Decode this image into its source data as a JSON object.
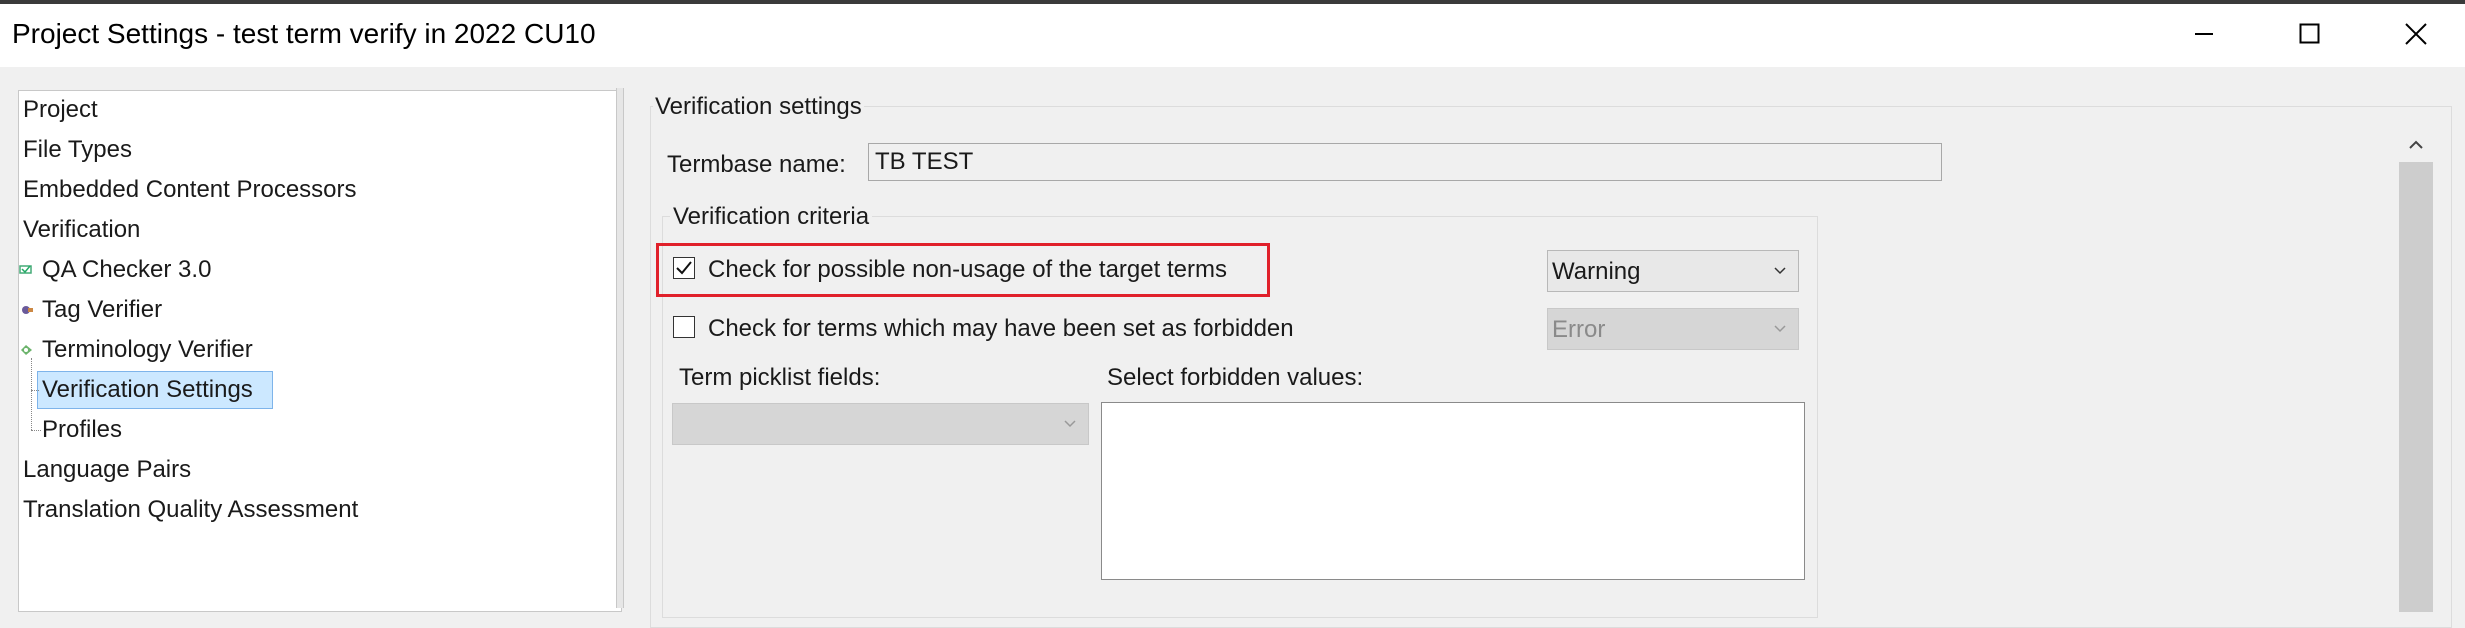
{
  "window": {
    "title": "Project Settings - test term verify in 2022 CU10",
    "minimize_icon": "minimize-icon",
    "maximize_icon": "maximize-icon",
    "close_icon": "close-icon"
  },
  "tree": {
    "items": [
      {
        "label": "Project"
      },
      {
        "label": "File Types"
      },
      {
        "label": "Embedded Content Processors"
      },
      {
        "label": "Verification"
      },
      {
        "label": "QA Checker 3.0",
        "icon": "qa-checker-icon"
      },
      {
        "label": "Tag Verifier",
        "icon": "tag-verifier-icon"
      },
      {
        "label": "Terminology Verifier",
        "icon": "terminology-verifier-icon"
      },
      {
        "label": "Verification Settings",
        "selected": true
      },
      {
        "label": "Profiles"
      },
      {
        "label": "Language Pairs"
      },
      {
        "label": "Translation Quality Assessment"
      }
    ]
  },
  "main": {
    "group_title": "Verification settings",
    "termbase_label": "Termbase name:",
    "termbase_value": "TB TEST",
    "criteria_title": "Verification criteria",
    "check_nonusage": {
      "label": "Check for possible non-usage of the target terms",
      "checked": true,
      "severity": "Warning",
      "highlight_color": "#e0202a"
    },
    "check_forbidden": {
      "label": "Check for terms which may have been set as forbidden",
      "checked": false,
      "severity": "Error"
    },
    "picklist_label": "Term picklist fields:",
    "picklist_value": "",
    "forbidden_values_label": "Select forbidden values:"
  },
  "colors": {
    "selection_bg": "#cce8ff",
    "selection_border": "#7eb4ea",
    "highlight": "#e0202a"
  }
}
